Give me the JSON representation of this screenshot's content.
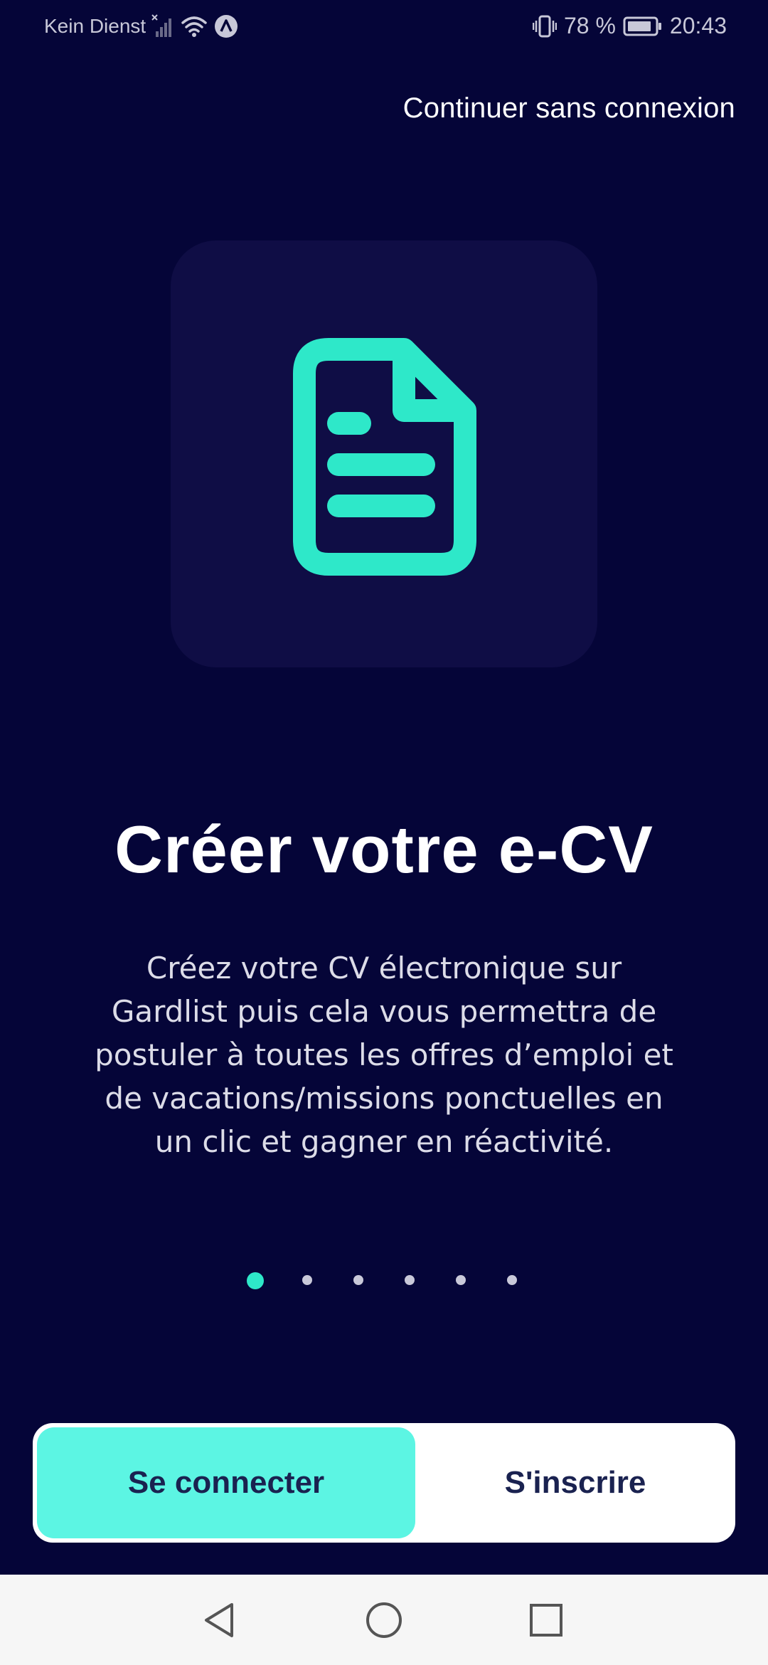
{
  "status_bar": {
    "carrier": "Kein Dienst",
    "battery_percent": "78 %",
    "time": "20:43",
    "icons": [
      "no-signal-icon",
      "wifi-icon",
      "vpn-icon",
      "vibrate-icon",
      "battery-icon"
    ]
  },
  "header": {
    "skip_label": "Continuer sans connexion"
  },
  "slide": {
    "icon": "document-icon",
    "title": "Créer votre e-CV",
    "description": "Créez votre CV électronique sur Gardlist puis cela vous permettra de postuler à toutes les offres d’emploi et de vacations/missions ponctuelles en un clic et gagner en réactivité."
  },
  "pager": {
    "total": 6,
    "active_index": 0
  },
  "auth": {
    "login_label": "Se connecter",
    "signup_label": "S'inscrire"
  },
  "nav_bar": {
    "buttons": [
      "back-icon",
      "home-icon",
      "recents-icon"
    ]
  },
  "colors": {
    "background": "#050538",
    "card": "#0f0d45",
    "accent": "#2ee8c9",
    "login_button": "#5cf5e3",
    "button_text": "#1a2250"
  }
}
